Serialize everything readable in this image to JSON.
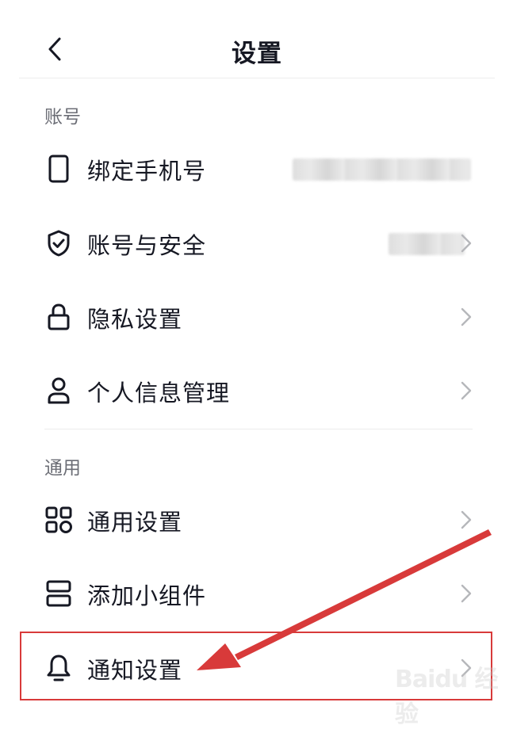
{
  "header": {
    "title": "设置",
    "back_icon": "chevron-left-icon"
  },
  "sections": [
    {
      "title": "账号",
      "items": [
        {
          "label": "绑定手机号",
          "icon": "phone-icon",
          "value": "",
          "value_hidden": true
        },
        {
          "label": "账号与安全",
          "icon": "shield-check-icon",
          "value": "",
          "value_hidden": true
        },
        {
          "label": "隐私设置",
          "icon": "lock-icon"
        },
        {
          "label": "个人信息管理",
          "icon": "user-icon"
        }
      ]
    },
    {
      "title": "通用",
      "items": [
        {
          "label": "通用设置",
          "icon": "grid-icon"
        },
        {
          "label": "添加小组件",
          "icon": "widget-icon"
        },
        {
          "label": "通知设置",
          "icon": "bell-icon",
          "highlighted": true
        }
      ]
    }
  ],
  "annotation": {
    "highlight_color": "#d83a3a",
    "highlighted_item": "通知设置"
  },
  "colors": {
    "text_primary": "#161823",
    "text_secondary": "#6b6d75",
    "divider": "#ececec",
    "chevron": "#b6b7bb"
  },
  "watermark": "Baidu 经验"
}
